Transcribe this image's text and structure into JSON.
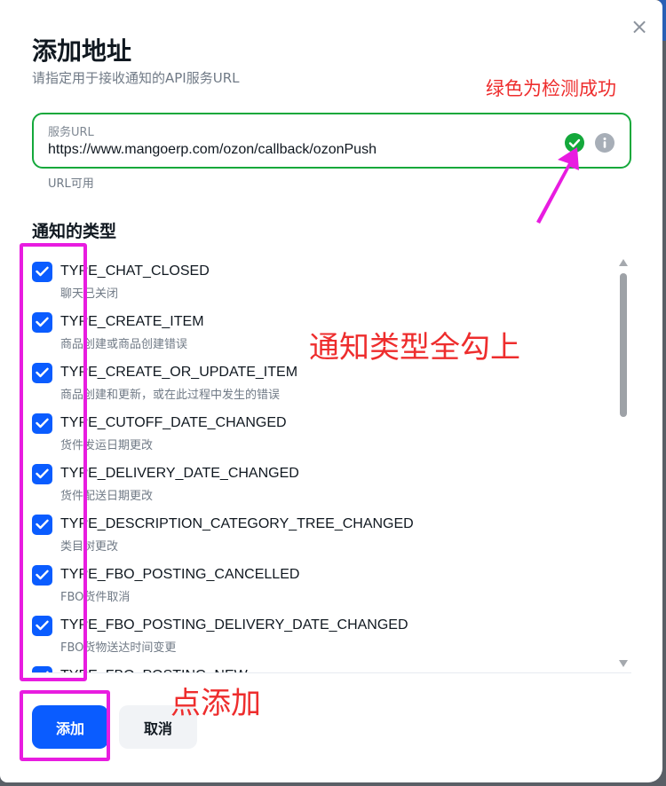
{
  "dialog": {
    "title": "添加地址",
    "subtitle": "请指定用于接收通知的API服务URL",
    "close_label": "×"
  },
  "url_field": {
    "label": "服务URL",
    "value": "https://www.mangoerp.com/ozon/callback/ozonPush",
    "hint": "URL可用",
    "status_icon": "check-circle-icon",
    "info_icon": "info-icon",
    "border_color": "#14a83b"
  },
  "notification_types": {
    "title": "通知的类型",
    "items": [
      {
        "name": "TYPE_CHAT_CLOSED",
        "desc": "聊天已关闭",
        "checked": true
      },
      {
        "name": "TYPE_CREATE_ITEM",
        "desc": "商品创建或商品创建错误",
        "checked": true
      },
      {
        "name": "TYPE_CREATE_OR_UPDATE_ITEM",
        "desc": "商品创建和更新，或在此过程中发生的错误",
        "checked": true
      },
      {
        "name": "TYPE_CUTOFF_DATE_CHANGED",
        "desc": "货件发运日期更改",
        "checked": true
      },
      {
        "name": "TYPE_DELIVERY_DATE_CHANGED",
        "desc": "货件配送日期更改",
        "checked": true
      },
      {
        "name": "TYPE_DESCRIPTION_CATEGORY_TREE_CHANGED",
        "desc": "类目树更改",
        "checked": true
      },
      {
        "name": "TYPE_FBO_POSTING_CANCELLED",
        "desc": "FBO货件取消",
        "checked": true
      },
      {
        "name": "TYPE_FBO_POSTING_DELIVERY_DATE_CHANGED",
        "desc": "FBO货物送达时间变更",
        "checked": true
      },
      {
        "name": "TYPE_FBO_POSTING_NEW",
        "desc": "",
        "checked": true
      }
    ]
  },
  "buttons": {
    "add": "添加",
    "cancel": "取消"
  },
  "annotations": {
    "green_success": "绿色为检测成功",
    "check_all": "通知类型全勾上",
    "click_add": "点添加",
    "color": "#e81ce0",
    "text_color": "#ee2d2d"
  },
  "colors": {
    "accent": "#0a5cff",
    "success": "#14a83b"
  }
}
